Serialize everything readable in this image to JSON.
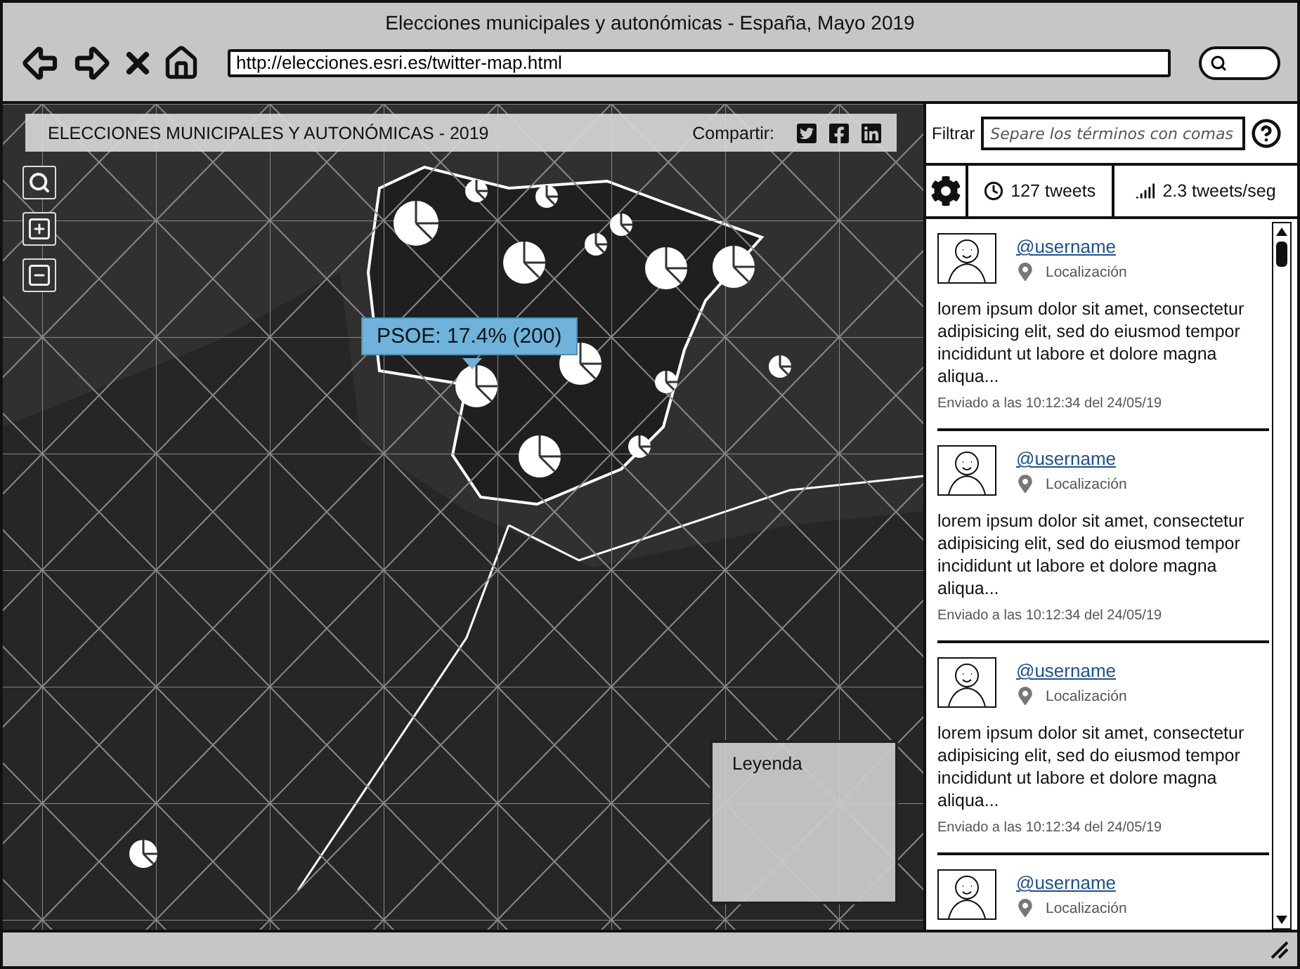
{
  "browser": {
    "title": "Elecciones municipales y autonómicas - España, Mayo 2019",
    "url": "http://elecciones.esri.es/twitter-map.html"
  },
  "map": {
    "title": "ELECCIONES MUNICIPALES Y AUTONÓMICAS - 2019",
    "share_label": "Compartir:",
    "tooltip": "PSOE: 17.4% (200)",
    "legend_title": "Leyenda"
  },
  "filter": {
    "label": "Filtrar",
    "placeholder": "Separe los términos con comas"
  },
  "stats": {
    "count": "127 tweets",
    "rate": "2.3 tweets/seg"
  },
  "tweets": [
    {
      "username": "@username",
      "location": "Localización",
      "text": "lorem ipsum dolor sit amet, consectetur adipisicing elit, sed do eiusmod tempor incididunt ut labore et dolore magna aliqua...",
      "sent": "Enviado a las 10:12:34 del 24/05/19"
    },
    {
      "username": "@username",
      "location": "Localización",
      "text": "lorem ipsum dolor sit amet, consectetur adipisicing elit, sed do eiusmod tempor incididunt ut labore et dolore magna aliqua...",
      "sent": "Enviado a las 10:12:34 del 24/05/19"
    },
    {
      "username": "@username",
      "location": "Localización",
      "text": "lorem ipsum dolor sit amet, consectetur adipisicing elit, sed do eiusmod tempor incididunt ut labore et dolore magna aliqua...",
      "sent": "Enviado a las 10:12:34 del 24/05/19"
    },
    {
      "username": "@username",
      "location": "Localización"
    }
  ]
}
